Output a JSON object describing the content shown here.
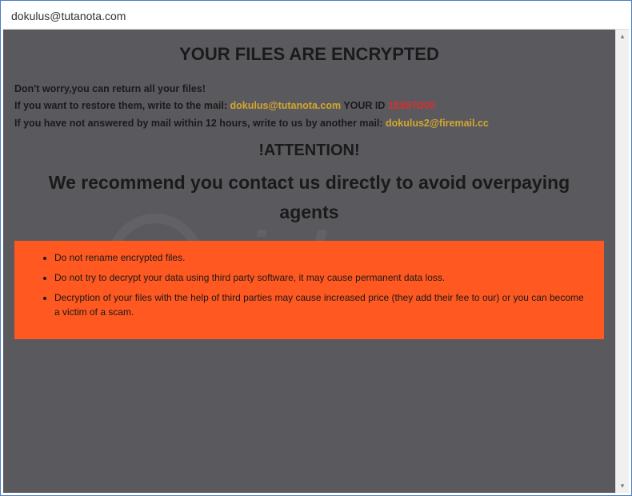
{
  "window": {
    "title": "dokulus@tutanota.com"
  },
  "content": {
    "main_heading": "YOUR FILES ARE ENCRYPTED",
    "line1": "Don't worry,you can return all your files!",
    "line2_prefix": "If you want to restore them, write to the mail:  ",
    "email1": "dokulus@tutanota.com",
    "your_id_label": "  YOUR ID ",
    "your_id_value": "1E857D00",
    "line3_prefix": "If you have not answered by mail within 12 hours, write to us by another mail: ",
    "email2": "dokulus2@firemail.cc",
    "attention_heading": "!ATTENTION!",
    "recommend_heading": "We recommend you contact us directly to avoid overpaying agents",
    "warnings": [
      "Do not rename encrypted files.",
      "Do not try to decrypt your data using third party software, it may cause permanent data loss.",
      "Decryption of your files with the help of third parties may cause increased price (they add their fee to our) or you can become a victim of a scam."
    ]
  }
}
